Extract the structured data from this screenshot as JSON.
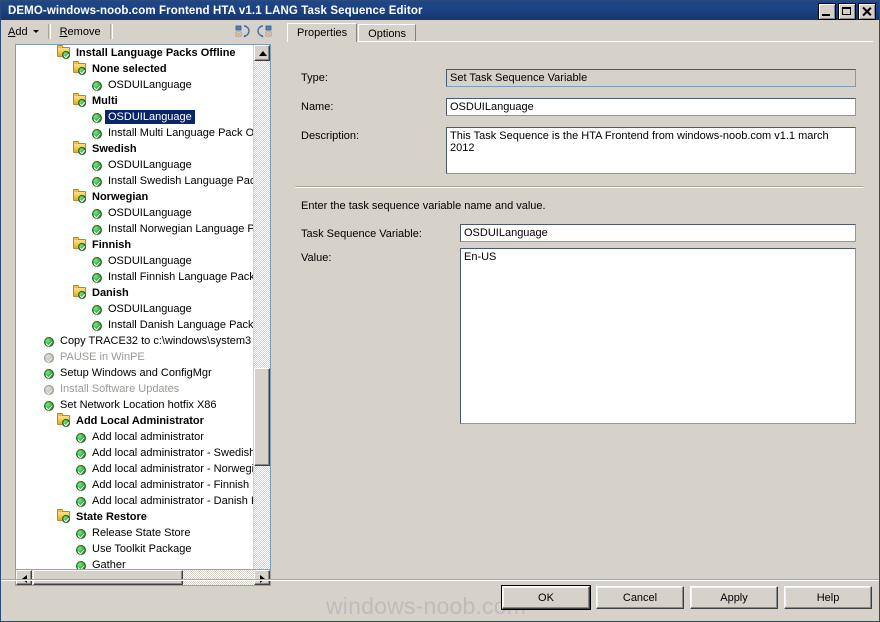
{
  "window": {
    "title": "DEMO-windows-noob.com Frontend HTA v1.1 LANG Task Sequence Editor",
    "minimize_label": "Minimize",
    "maximize_label": "Maximize",
    "close_label": "Close"
  },
  "toolbar": {
    "add_label": "Add",
    "remove_label": "Remove",
    "icon_collapse_label": "collapse-all",
    "icon_expand_label": "expand-all"
  },
  "tree": {
    "items": [
      {
        "label": "Install Language Packs Offline",
        "icon": "folder",
        "indent": 0,
        "bold": true,
        "disabled": false,
        "selected": false
      },
      {
        "label": "None selected",
        "icon": "folder",
        "indent": 1,
        "bold": true,
        "disabled": false,
        "selected": false
      },
      {
        "label": "OSDUILanguage",
        "icon": "check",
        "indent": 2,
        "bold": false,
        "disabled": false,
        "selected": false
      },
      {
        "label": "Multi",
        "icon": "folder",
        "indent": 1,
        "bold": true,
        "disabled": false,
        "selected": false
      },
      {
        "label": "OSDUILanguage",
        "icon": "check",
        "indent": 2,
        "bold": false,
        "disabled": false,
        "selected": true
      },
      {
        "label": "Install Multi Language Pack Offl",
        "icon": "check",
        "indent": 2,
        "bold": false,
        "disabled": false,
        "selected": false
      },
      {
        "label": "Swedish",
        "icon": "folder",
        "indent": 1,
        "bold": true,
        "disabled": false,
        "selected": false
      },
      {
        "label": "OSDUILanguage",
        "icon": "check",
        "indent": 2,
        "bold": false,
        "disabled": false,
        "selected": false
      },
      {
        "label": "Install Swedish Language Pack",
        "icon": "check",
        "indent": 2,
        "bold": false,
        "disabled": false,
        "selected": false
      },
      {
        "label": "Norwegian",
        "icon": "folder",
        "indent": 1,
        "bold": true,
        "disabled": false,
        "selected": false
      },
      {
        "label": "OSDUILanguage",
        "icon": "check",
        "indent": 2,
        "bold": false,
        "disabled": false,
        "selected": false
      },
      {
        "label": "Install Norwegian Language Pa",
        "icon": "check",
        "indent": 2,
        "bold": false,
        "disabled": false,
        "selected": false
      },
      {
        "label": "Finnish",
        "icon": "folder",
        "indent": 1,
        "bold": true,
        "disabled": false,
        "selected": false
      },
      {
        "label": "OSDUILanguage",
        "icon": "check",
        "indent": 2,
        "bold": false,
        "disabled": false,
        "selected": false
      },
      {
        "label": "Install Finnish Language Pack O",
        "icon": "check",
        "indent": 2,
        "bold": false,
        "disabled": false,
        "selected": false
      },
      {
        "label": "Danish",
        "icon": "folder",
        "indent": 1,
        "bold": true,
        "disabled": false,
        "selected": false
      },
      {
        "label": "OSDUILanguage",
        "icon": "check",
        "indent": 2,
        "bold": false,
        "disabled": false,
        "selected": false
      },
      {
        "label": "Install Danish Language Pack O",
        "icon": "check",
        "indent": 2,
        "bold": false,
        "disabled": false,
        "selected": false
      },
      {
        "label": "Copy TRACE32 to c:\\windows\\system3",
        "icon": "check",
        "indent": -1,
        "bold": false,
        "disabled": false,
        "selected": false
      },
      {
        "label": "PAUSE in WinPE",
        "icon": "check",
        "indent": -1,
        "bold": false,
        "disabled": true,
        "selected": false
      },
      {
        "label": "Setup Windows and ConfigMgr",
        "icon": "check",
        "indent": -1,
        "bold": false,
        "disabled": false,
        "selected": false
      },
      {
        "label": "Install Software Updates",
        "icon": "check",
        "indent": -1,
        "bold": false,
        "disabled": true,
        "selected": false
      },
      {
        "label": "Set Network Location hotfix X86",
        "icon": "check",
        "indent": -1,
        "bold": false,
        "disabled": false,
        "selected": false
      },
      {
        "label": "Add Local Administrator",
        "icon": "folder",
        "indent": 0,
        "bold": true,
        "disabled": false,
        "selected": false
      },
      {
        "label": "Add local administrator",
        "icon": "check",
        "indent": 1,
        "bold": false,
        "disabled": false,
        "selected": false
      },
      {
        "label": "Add local administrator - Swedish L",
        "icon": "check",
        "indent": 1,
        "bold": false,
        "disabled": false,
        "selected": false
      },
      {
        "label": "Add local administrator - Norwegian",
        "icon": "check",
        "indent": 1,
        "bold": false,
        "disabled": false,
        "selected": false
      },
      {
        "label": "Add local administrator - Finnish La",
        "icon": "check",
        "indent": 1,
        "bold": false,
        "disabled": false,
        "selected": false
      },
      {
        "label": "Add local administrator - Danish La",
        "icon": "check",
        "indent": 1,
        "bold": false,
        "disabled": false,
        "selected": false
      },
      {
        "label": "State Restore",
        "icon": "folder",
        "indent": 0,
        "bold": true,
        "disabled": false,
        "selected": false
      },
      {
        "label": "Release State Store",
        "icon": "check",
        "indent": 1,
        "bold": false,
        "disabled": false,
        "selected": false
      },
      {
        "label": "Use Toolkit Package",
        "icon": "check",
        "indent": 1,
        "bold": false,
        "disabled": false,
        "selected": false
      },
      {
        "label": "Gather",
        "icon": "check",
        "indent": 1,
        "bold": false,
        "disabled": false,
        "selected": false
      }
    ]
  },
  "tabs": [
    {
      "label": "Properties",
      "active": true
    },
    {
      "label": "Options",
      "active": false
    }
  ],
  "properties": {
    "type_label": "Type:",
    "type_value": "Set Task Sequence Variable",
    "name_label": "Name:",
    "name_value": "OSDUILanguage",
    "description_label": "Description:",
    "description_value": "This Task Sequence is the HTA Frontend from windows-noob.com v1.1 march 2012",
    "instruction": "Enter the task sequence variable name and value.",
    "variable_label": "Task Sequence Variable:",
    "variable_value": "OSDUILanguage",
    "value_label": "Value:",
    "value_value": "En-US"
  },
  "buttons": {
    "ok": "OK",
    "cancel": "Cancel",
    "apply": "Apply",
    "help": "Help"
  },
  "watermark": {
    "text": "windows-noob.com"
  }
}
